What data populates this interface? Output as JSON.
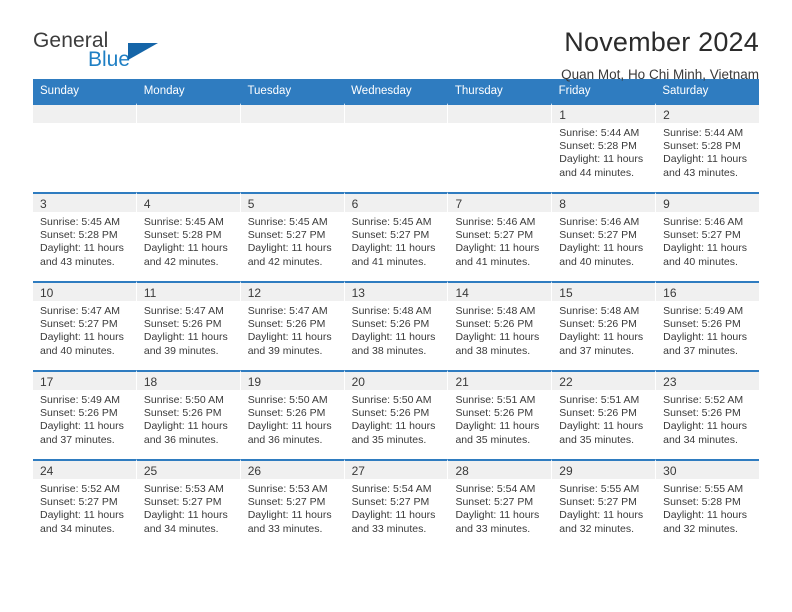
{
  "logo": {
    "line1": "General",
    "line2": "Blue",
    "triangle_color": "#1565a8"
  },
  "header": {
    "title": "November 2024",
    "subtitle": "Quan Mot, Ho Chi Minh, Vietnam"
  },
  "theme": {
    "accent": "#2f7cc0",
    "band": "#f0f0f0",
    "text": "#3a3a3a"
  },
  "weekdays": [
    "Sunday",
    "Monday",
    "Tuesday",
    "Wednesday",
    "Thursday",
    "Friday",
    "Saturday"
  ],
  "weeks": [
    [
      {
        "day": "",
        "empty": true
      },
      {
        "day": "",
        "empty": true
      },
      {
        "day": "",
        "empty": true
      },
      {
        "day": "",
        "empty": true
      },
      {
        "day": "",
        "empty": true
      },
      {
        "day": "1",
        "sunrise": "Sunrise: 5:44 AM",
        "sunset": "Sunset: 5:28 PM",
        "daylight1": "Daylight: 11 hours",
        "daylight2": "and 44 minutes."
      },
      {
        "day": "2",
        "sunrise": "Sunrise: 5:44 AM",
        "sunset": "Sunset: 5:28 PM",
        "daylight1": "Daylight: 11 hours",
        "daylight2": "and 43 minutes."
      }
    ],
    [
      {
        "day": "3",
        "sunrise": "Sunrise: 5:45 AM",
        "sunset": "Sunset: 5:28 PM",
        "daylight1": "Daylight: 11 hours",
        "daylight2": "and 43 minutes."
      },
      {
        "day": "4",
        "sunrise": "Sunrise: 5:45 AM",
        "sunset": "Sunset: 5:28 PM",
        "daylight1": "Daylight: 11 hours",
        "daylight2": "and 42 minutes."
      },
      {
        "day": "5",
        "sunrise": "Sunrise: 5:45 AM",
        "sunset": "Sunset: 5:27 PM",
        "daylight1": "Daylight: 11 hours",
        "daylight2": "and 42 minutes."
      },
      {
        "day": "6",
        "sunrise": "Sunrise: 5:45 AM",
        "sunset": "Sunset: 5:27 PM",
        "daylight1": "Daylight: 11 hours",
        "daylight2": "and 41 minutes."
      },
      {
        "day": "7",
        "sunrise": "Sunrise: 5:46 AM",
        "sunset": "Sunset: 5:27 PM",
        "daylight1": "Daylight: 11 hours",
        "daylight2": "and 41 minutes."
      },
      {
        "day": "8",
        "sunrise": "Sunrise: 5:46 AM",
        "sunset": "Sunset: 5:27 PM",
        "daylight1": "Daylight: 11 hours",
        "daylight2": "and 40 minutes."
      },
      {
        "day": "9",
        "sunrise": "Sunrise: 5:46 AM",
        "sunset": "Sunset: 5:27 PM",
        "daylight1": "Daylight: 11 hours",
        "daylight2": "and 40 minutes."
      }
    ],
    [
      {
        "day": "10",
        "sunrise": "Sunrise: 5:47 AM",
        "sunset": "Sunset: 5:27 PM",
        "daylight1": "Daylight: 11 hours",
        "daylight2": "and 40 minutes."
      },
      {
        "day": "11",
        "sunrise": "Sunrise: 5:47 AM",
        "sunset": "Sunset: 5:26 PM",
        "daylight1": "Daylight: 11 hours",
        "daylight2": "and 39 minutes."
      },
      {
        "day": "12",
        "sunrise": "Sunrise: 5:47 AM",
        "sunset": "Sunset: 5:26 PM",
        "daylight1": "Daylight: 11 hours",
        "daylight2": "and 39 minutes."
      },
      {
        "day": "13",
        "sunrise": "Sunrise: 5:48 AM",
        "sunset": "Sunset: 5:26 PM",
        "daylight1": "Daylight: 11 hours",
        "daylight2": "and 38 minutes."
      },
      {
        "day": "14",
        "sunrise": "Sunrise: 5:48 AM",
        "sunset": "Sunset: 5:26 PM",
        "daylight1": "Daylight: 11 hours",
        "daylight2": "and 38 minutes."
      },
      {
        "day": "15",
        "sunrise": "Sunrise: 5:48 AM",
        "sunset": "Sunset: 5:26 PM",
        "daylight1": "Daylight: 11 hours",
        "daylight2": "and 37 minutes."
      },
      {
        "day": "16",
        "sunrise": "Sunrise: 5:49 AM",
        "sunset": "Sunset: 5:26 PM",
        "daylight1": "Daylight: 11 hours",
        "daylight2": "and 37 minutes."
      }
    ],
    [
      {
        "day": "17",
        "sunrise": "Sunrise: 5:49 AM",
        "sunset": "Sunset: 5:26 PM",
        "daylight1": "Daylight: 11 hours",
        "daylight2": "and 37 minutes."
      },
      {
        "day": "18",
        "sunrise": "Sunrise: 5:50 AM",
        "sunset": "Sunset: 5:26 PM",
        "daylight1": "Daylight: 11 hours",
        "daylight2": "and 36 minutes."
      },
      {
        "day": "19",
        "sunrise": "Sunrise: 5:50 AM",
        "sunset": "Sunset: 5:26 PM",
        "daylight1": "Daylight: 11 hours",
        "daylight2": "and 36 minutes."
      },
      {
        "day": "20",
        "sunrise": "Sunrise: 5:50 AM",
        "sunset": "Sunset: 5:26 PM",
        "daylight1": "Daylight: 11 hours",
        "daylight2": "and 35 minutes."
      },
      {
        "day": "21",
        "sunrise": "Sunrise: 5:51 AM",
        "sunset": "Sunset: 5:26 PM",
        "daylight1": "Daylight: 11 hours",
        "daylight2": "and 35 minutes."
      },
      {
        "day": "22",
        "sunrise": "Sunrise: 5:51 AM",
        "sunset": "Sunset: 5:26 PM",
        "daylight1": "Daylight: 11 hours",
        "daylight2": "and 35 minutes."
      },
      {
        "day": "23",
        "sunrise": "Sunrise: 5:52 AM",
        "sunset": "Sunset: 5:26 PM",
        "daylight1": "Daylight: 11 hours",
        "daylight2": "and 34 minutes."
      }
    ],
    [
      {
        "day": "24",
        "sunrise": "Sunrise: 5:52 AM",
        "sunset": "Sunset: 5:27 PM",
        "daylight1": "Daylight: 11 hours",
        "daylight2": "and 34 minutes."
      },
      {
        "day": "25",
        "sunrise": "Sunrise: 5:53 AM",
        "sunset": "Sunset: 5:27 PM",
        "daylight1": "Daylight: 11 hours",
        "daylight2": "and 34 minutes."
      },
      {
        "day": "26",
        "sunrise": "Sunrise: 5:53 AM",
        "sunset": "Sunset: 5:27 PM",
        "daylight1": "Daylight: 11 hours",
        "daylight2": "and 33 minutes."
      },
      {
        "day": "27",
        "sunrise": "Sunrise: 5:54 AM",
        "sunset": "Sunset: 5:27 PM",
        "daylight1": "Daylight: 11 hours",
        "daylight2": "and 33 minutes."
      },
      {
        "day": "28",
        "sunrise": "Sunrise: 5:54 AM",
        "sunset": "Sunset: 5:27 PM",
        "daylight1": "Daylight: 11 hours",
        "daylight2": "and 33 minutes."
      },
      {
        "day": "29",
        "sunrise": "Sunrise: 5:55 AM",
        "sunset": "Sunset: 5:27 PM",
        "daylight1": "Daylight: 11 hours",
        "daylight2": "and 32 minutes."
      },
      {
        "day": "30",
        "sunrise": "Sunrise: 5:55 AM",
        "sunset": "Sunset: 5:28 PM",
        "daylight1": "Daylight: 11 hours",
        "daylight2": "and 32 minutes."
      }
    ]
  ]
}
